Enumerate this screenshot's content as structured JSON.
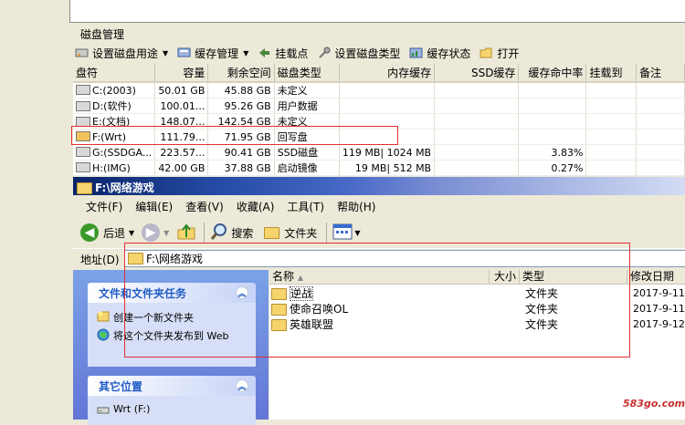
{
  "disk_manager": {
    "title": "磁盘管理",
    "toolbar": [
      {
        "label": "设置磁盘用途",
        "icon": "disk-purpose-icon",
        "dropdown": true
      },
      {
        "label": "缓存管理",
        "icon": "cache-manage-icon",
        "dropdown": true
      },
      {
        "label": "挂载点",
        "icon": "mount-icon",
        "dropdown": false
      },
      {
        "label": "设置磁盘类型",
        "icon": "disk-type-icon",
        "dropdown": false
      },
      {
        "label": "缓存状态",
        "icon": "cache-status-icon",
        "dropdown": false
      },
      {
        "label": "打开",
        "icon": "open-icon",
        "dropdown": false
      }
    ],
    "columns": [
      "盘符",
      "容量",
      "剩余空间",
      "磁盘类型",
      "内存缓存",
      "SSD缓存",
      "缓存命中率",
      "挂载到",
      "备注"
    ],
    "rows": [
      {
        "drive": "C:(2003)",
        "capacity": "50.01 GB",
        "free": "45.88 GB",
        "type": "未定义",
        "mem_cache": "",
        "ssd_cache": "",
        "hit_rate": "",
        "mount": "",
        "note": ""
      },
      {
        "drive": "D:(软件)",
        "capacity": "100.01...",
        "free": "95.26 GB",
        "type": "用户数据",
        "mem_cache": "",
        "ssd_cache": "",
        "hit_rate": "",
        "mount": "",
        "note": ""
      },
      {
        "drive": "E:(文档)",
        "capacity": "148.07...",
        "free": "142.54 GB",
        "type": "未定义",
        "mem_cache": "",
        "ssd_cache": "",
        "hit_rate": "",
        "mount": "",
        "note": ""
      },
      {
        "drive": "F:(Wrt)",
        "capacity": "111.79...",
        "free": "71.95 GB",
        "type": "回写盘",
        "mem_cache": "",
        "ssd_cache": "",
        "hit_rate": "",
        "mount": "",
        "note": ""
      },
      {
        "drive": "G:(SSDGA...",
        "capacity": "223.57...",
        "free": "90.41 GB",
        "type": "SSD磁盘",
        "mem_cache": "119 MB| 1024 MB",
        "ssd_cache": "",
        "hit_rate": "3.83%",
        "mount": "",
        "note": ""
      },
      {
        "drive": "H:(IMG)",
        "capacity": "42.00 GB",
        "free": "37.88 GB",
        "type": "启动镜像",
        "mem_cache": "19 MB| 512 MB",
        "ssd_cache": "",
        "hit_rate": "0.27%",
        "mount": "",
        "note": ""
      }
    ]
  },
  "explorer": {
    "title": "F:\\网络游戏",
    "menu": [
      "文件(F)",
      "编辑(E)",
      "查看(V)",
      "收藏(A)",
      "工具(T)",
      "帮助(H)"
    ],
    "nav": {
      "back": "后退",
      "search": "搜索",
      "folders": "文件夹"
    },
    "address": {
      "label": "地址(D)",
      "value": "F:\\网络游戏"
    },
    "tasks": {
      "title": "文件和文件夹任务",
      "items": [
        "创建一个新文件夹",
        "将这个文件夹发布到 Web"
      ]
    },
    "other_places": {
      "title": "其它位置",
      "items": [
        "Wrt (F:)"
      ]
    },
    "list": {
      "columns": [
        "名称",
        "大小",
        "类型",
        "修改日期"
      ],
      "files": [
        {
          "name": "逆战",
          "size": "",
          "type": "文件夹",
          "date": "2017-9-11"
        },
        {
          "name": "使命召唤OL",
          "size": "",
          "type": "文件夹",
          "date": "2017-9-11"
        },
        {
          "name": "英雄联盟",
          "size": "",
          "type": "文件夹",
          "date": "2017-9-12"
        }
      ]
    }
  },
  "watermark": "583go.com",
  "colors": {
    "highlight_box": "#e03030",
    "title_bar": "#0a246a",
    "task_pane": "#6375d6"
  }
}
